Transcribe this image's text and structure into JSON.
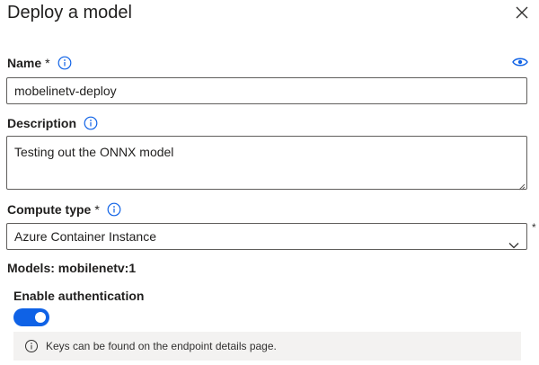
{
  "panel": {
    "title": "Deploy a model"
  },
  "name_field": {
    "label": "Name",
    "required_marker": "*",
    "value": "mobelinetv-deploy"
  },
  "description_field": {
    "label": "Description",
    "value": "Testing out the ONNX model"
  },
  "compute_type": {
    "label": "Compute type",
    "required_marker": "*",
    "selected": "Azure Container Instance",
    "side_marker": "*"
  },
  "models": {
    "text": "Models: mobilenetv:1"
  },
  "authentication": {
    "label": "Enable authentication",
    "enabled": true
  },
  "info_bar": {
    "text": "Keys can be found on the endpoint details page."
  },
  "icons": {
    "close": "close-icon",
    "info": "info-icon",
    "eye": "eye-icon",
    "chevron": "chevron-down-icon"
  },
  "colors": {
    "accent": "#0f62e6",
    "info_bar_bg": "#f3f2f1",
    "border": "#605e5c"
  }
}
